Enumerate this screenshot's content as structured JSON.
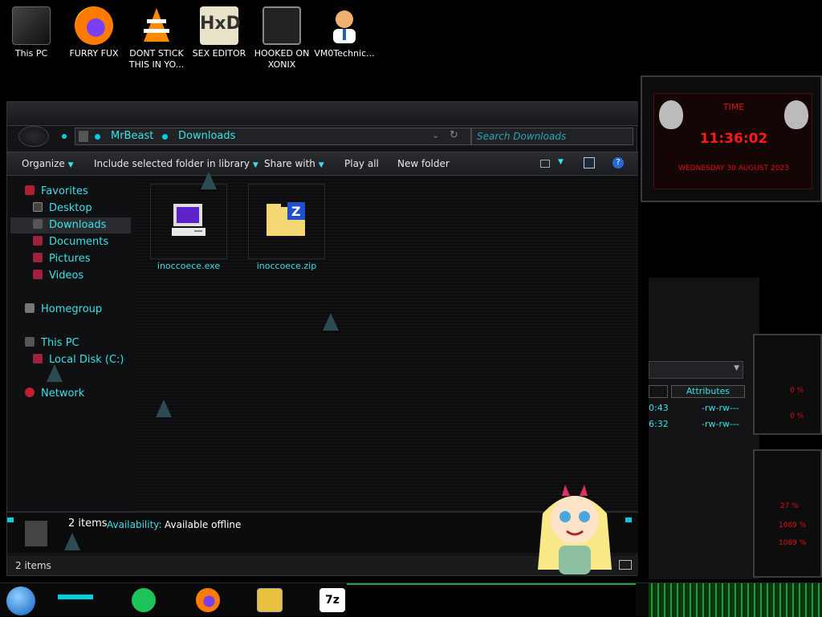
{
  "desktop_icons": [
    {
      "label": "This PC"
    },
    {
      "label": "FURRY FUX"
    },
    {
      "label": "DONT STICK THIS IN YO..."
    },
    {
      "label": "SEX EDITOR"
    },
    {
      "label": "HOOKED ON XONIX"
    },
    {
      "label": "VM0Technic..."
    }
  ],
  "explorer": {
    "breadcrumb": [
      "MrBeast",
      "Downloads"
    ],
    "search_placeholder": "Search Downloads",
    "toolbar": {
      "organize": "Organize",
      "include": "Include selected folder in library",
      "share": "Share with",
      "play_all": "Play all",
      "new_folder": "New folder"
    },
    "nav": {
      "favorites": "Favorites",
      "desktop": "Desktop",
      "downloads": "Downloads",
      "documents": "Documents",
      "pictures": "Pictures",
      "videos": "Videos",
      "homegroup": "Homegroup",
      "this_pc": "This PC",
      "local_disk": "Local Disk (C:)",
      "network": "Network"
    },
    "files": [
      {
        "name": "inoccoece.exe",
        "icon": "computer-icon"
      },
      {
        "name": "inoccoece.zip",
        "icon": "zip-folder-icon"
      }
    ],
    "details": {
      "count": "2 items",
      "availability_label": "Availability:",
      "availability_value": "Available offline"
    },
    "status": "2 items"
  },
  "clock_gadget": {
    "label": "TIME",
    "time": "11:36:02",
    "date": "WEDNESDAY 30 AUGUST 2023"
  },
  "right_panel": {
    "col_header": "Attributes",
    "rows": [
      {
        "time": "0:43",
        "attr": "-rw-rw---"
      },
      {
        "time": "6:32",
        "attr": "-rw-rw---"
      }
    ]
  },
  "meters": [
    "0 %",
    "0 %",
    "27 %",
    "1089 %",
    "1089 %"
  ],
  "colors": {
    "accent": "#3de0e8",
    "red": "#e01010"
  }
}
